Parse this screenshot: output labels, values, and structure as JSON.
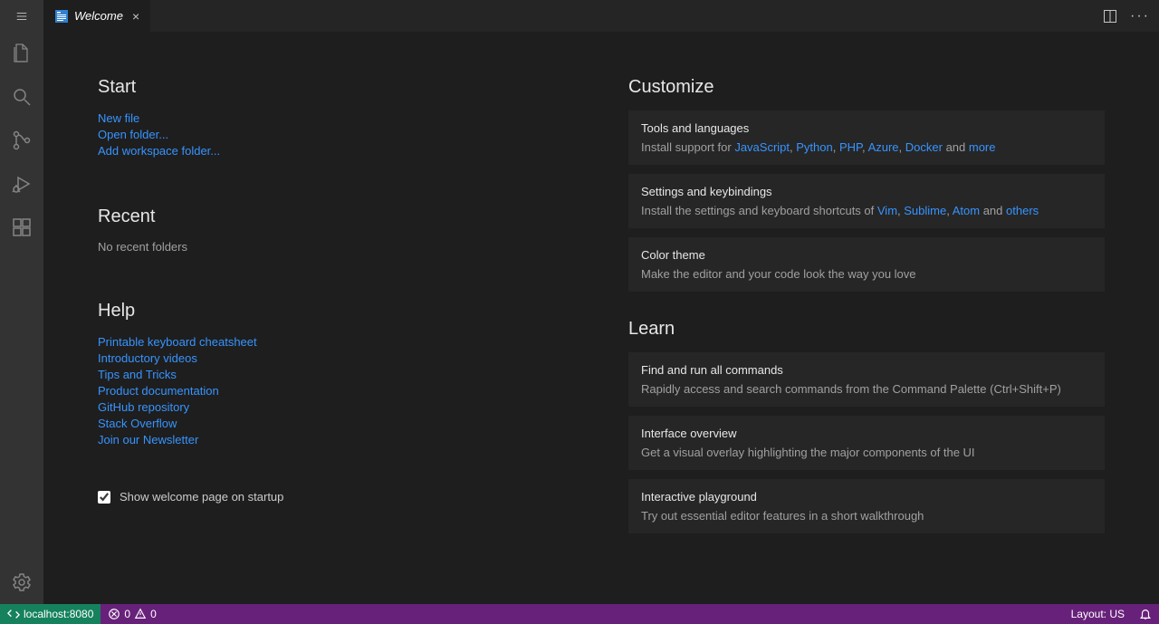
{
  "tab": {
    "label": "Welcome"
  },
  "start": {
    "heading": "Start",
    "links": [
      "New file",
      "Open folder...",
      "Add workspace folder..."
    ]
  },
  "recent": {
    "heading": "Recent",
    "empty": "No recent folders"
  },
  "help": {
    "heading": "Help",
    "links": [
      "Printable keyboard cheatsheet",
      "Introductory videos",
      "Tips and Tricks",
      "Product documentation",
      "GitHub repository",
      "Stack Overflow",
      "Join our Newsletter"
    ]
  },
  "welcome_checkbox": "Show welcome page on startup",
  "customize": {
    "heading": "Customize",
    "cards": {
      "tools": {
        "title": "Tools and languages",
        "prefix": "Install support for ",
        "links": [
          "JavaScript",
          "Python",
          "PHP",
          "Azure",
          "Docker"
        ],
        "and": " and ",
        "more": "more"
      },
      "settings": {
        "title": "Settings and keybindings",
        "prefix": "Install the settings and keyboard shortcuts of ",
        "links": [
          "Vim",
          "Sublime",
          "Atom"
        ],
        "and": " and ",
        "more": "others"
      },
      "theme": {
        "title": "Color theme",
        "desc": "Make the editor and your code look the way you love"
      }
    }
  },
  "learn": {
    "heading": "Learn",
    "cards": [
      {
        "title": "Find and run all commands",
        "desc": "Rapidly access and search commands from the Command Palette (Ctrl+Shift+P)"
      },
      {
        "title": "Interface overview",
        "desc": "Get a visual overlay highlighting the major components of the UI"
      },
      {
        "title": "Interactive playground",
        "desc": "Try out essential editor features in a short walkthrough"
      }
    ]
  },
  "status": {
    "remote": "localhost:8080",
    "errors": "0",
    "warnings": "0",
    "layout": "Layout: US"
  }
}
